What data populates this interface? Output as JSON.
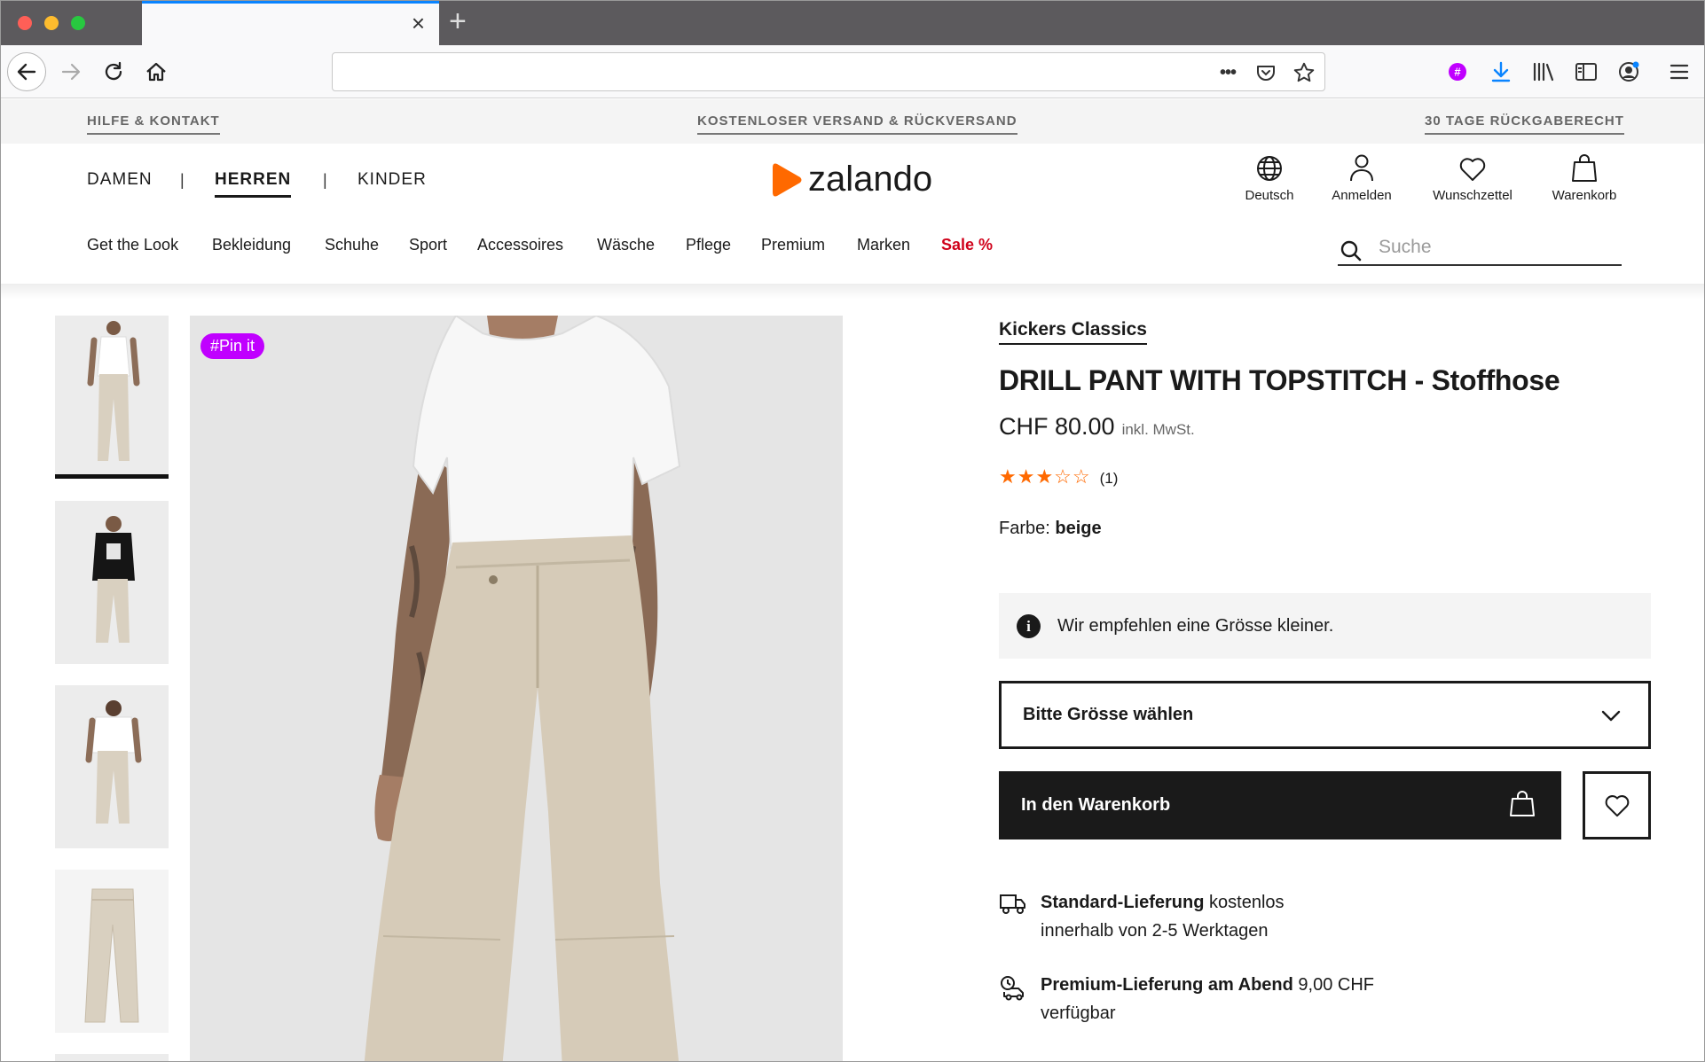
{
  "browser": {
    "tab_close": "×",
    "new_tab": "+",
    "url": "",
    "more_icon": "•••"
  },
  "promo": {
    "left": "HILFE & KONTAKT",
    "center": "KOSTENLOSER VERSAND & RÜCKVERSAND",
    "right": "30 TAGE RÜCKGABERECHT"
  },
  "header": {
    "genders": [
      "DAMEN",
      "HERREN",
      "KINDER"
    ],
    "separator": "|",
    "logo": "zalando",
    "utils": [
      "Deutsch",
      "Anmelden",
      "Wunschzettel",
      "Warenkorb"
    ]
  },
  "categories": [
    "Get the Look",
    "Bekleidung",
    "Schuhe",
    "Sport",
    "Accessoires",
    "Wäsche",
    "Pflege",
    "Premium",
    "Marken",
    "Sale %"
  ],
  "search": {
    "placeholder": "Suche"
  },
  "product": {
    "pin": "#Pin it",
    "brand": "Kickers Classics",
    "title": "DRILL PANT WITH TOPSTITCH - Stoffhose",
    "price": "CHF 80.00",
    "vat": "inkl. MwSt.",
    "stars_filled": "★★★",
    "stars_empty": "☆☆",
    "rating_value": 3,
    "rating_max": 5,
    "rating_count": "(1)",
    "color_label": "Farbe:",
    "color_value": "beige",
    "size_hint": "Wir empfehlen eine Grösse kleiner.",
    "size_select": "Bitte Grösse wählen",
    "add_to_cart": "In den Warenkorb"
  },
  "delivery": [
    {
      "title": "Standard-Lieferung",
      "rest": "kostenlos",
      "line2": "innerhalb von 2-5 Werktagen"
    },
    {
      "title": "Premium-Lieferung am Abend",
      "rest": "9,00 CHF",
      "line2": "verfügbar"
    }
  ],
  "colors": {
    "accent": "#ff6900",
    "sale": "#d0021b",
    "pin": "#c000ff",
    "tab_highlight": "#0a84ff"
  }
}
